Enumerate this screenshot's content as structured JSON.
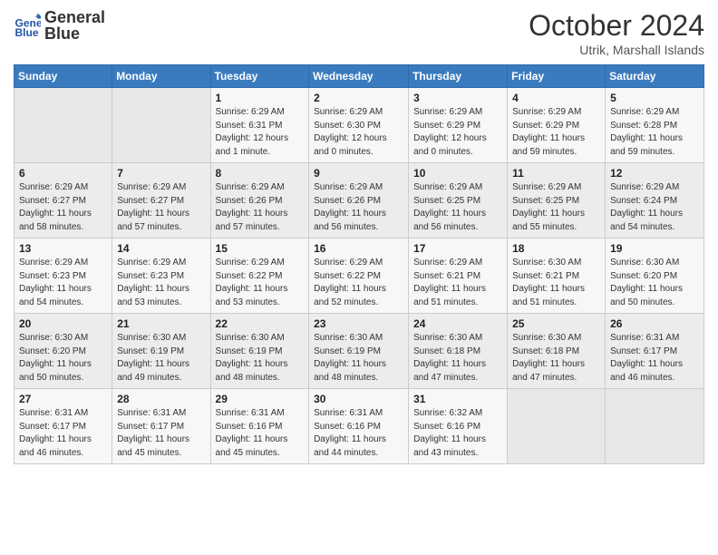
{
  "header": {
    "logo": {
      "line1": "General",
      "line2": "Blue"
    },
    "title": "October 2024",
    "location": "Utrik, Marshall Islands"
  },
  "weekdays": [
    "Sunday",
    "Monday",
    "Tuesday",
    "Wednesday",
    "Thursday",
    "Friday",
    "Saturday"
  ],
  "weeks": [
    [
      {
        "day": "",
        "detail": ""
      },
      {
        "day": "",
        "detail": ""
      },
      {
        "day": "1",
        "detail": "Sunrise: 6:29 AM\nSunset: 6:31 PM\nDaylight: 12 hours and 1 minute."
      },
      {
        "day": "2",
        "detail": "Sunrise: 6:29 AM\nSunset: 6:30 PM\nDaylight: 12 hours and 0 minutes."
      },
      {
        "day": "3",
        "detail": "Sunrise: 6:29 AM\nSunset: 6:29 PM\nDaylight: 12 hours and 0 minutes."
      },
      {
        "day": "4",
        "detail": "Sunrise: 6:29 AM\nSunset: 6:29 PM\nDaylight: 11 hours and 59 minutes."
      },
      {
        "day": "5",
        "detail": "Sunrise: 6:29 AM\nSunset: 6:28 PM\nDaylight: 11 hours and 59 minutes."
      }
    ],
    [
      {
        "day": "6",
        "detail": "Sunrise: 6:29 AM\nSunset: 6:27 PM\nDaylight: 11 hours and 58 minutes."
      },
      {
        "day": "7",
        "detail": "Sunrise: 6:29 AM\nSunset: 6:27 PM\nDaylight: 11 hours and 57 minutes."
      },
      {
        "day": "8",
        "detail": "Sunrise: 6:29 AM\nSunset: 6:26 PM\nDaylight: 11 hours and 57 minutes."
      },
      {
        "day": "9",
        "detail": "Sunrise: 6:29 AM\nSunset: 6:26 PM\nDaylight: 11 hours and 56 minutes."
      },
      {
        "day": "10",
        "detail": "Sunrise: 6:29 AM\nSunset: 6:25 PM\nDaylight: 11 hours and 56 minutes."
      },
      {
        "day": "11",
        "detail": "Sunrise: 6:29 AM\nSunset: 6:25 PM\nDaylight: 11 hours and 55 minutes."
      },
      {
        "day": "12",
        "detail": "Sunrise: 6:29 AM\nSunset: 6:24 PM\nDaylight: 11 hours and 54 minutes."
      }
    ],
    [
      {
        "day": "13",
        "detail": "Sunrise: 6:29 AM\nSunset: 6:23 PM\nDaylight: 11 hours and 54 minutes."
      },
      {
        "day": "14",
        "detail": "Sunrise: 6:29 AM\nSunset: 6:23 PM\nDaylight: 11 hours and 53 minutes."
      },
      {
        "day": "15",
        "detail": "Sunrise: 6:29 AM\nSunset: 6:22 PM\nDaylight: 11 hours and 53 minutes."
      },
      {
        "day": "16",
        "detail": "Sunrise: 6:29 AM\nSunset: 6:22 PM\nDaylight: 11 hours and 52 minutes."
      },
      {
        "day": "17",
        "detail": "Sunrise: 6:29 AM\nSunset: 6:21 PM\nDaylight: 11 hours and 51 minutes."
      },
      {
        "day": "18",
        "detail": "Sunrise: 6:30 AM\nSunset: 6:21 PM\nDaylight: 11 hours and 51 minutes."
      },
      {
        "day": "19",
        "detail": "Sunrise: 6:30 AM\nSunset: 6:20 PM\nDaylight: 11 hours and 50 minutes."
      }
    ],
    [
      {
        "day": "20",
        "detail": "Sunrise: 6:30 AM\nSunset: 6:20 PM\nDaylight: 11 hours and 50 minutes."
      },
      {
        "day": "21",
        "detail": "Sunrise: 6:30 AM\nSunset: 6:19 PM\nDaylight: 11 hours and 49 minutes."
      },
      {
        "day": "22",
        "detail": "Sunrise: 6:30 AM\nSunset: 6:19 PM\nDaylight: 11 hours and 48 minutes."
      },
      {
        "day": "23",
        "detail": "Sunrise: 6:30 AM\nSunset: 6:19 PM\nDaylight: 11 hours and 48 minutes."
      },
      {
        "day": "24",
        "detail": "Sunrise: 6:30 AM\nSunset: 6:18 PM\nDaylight: 11 hours and 47 minutes."
      },
      {
        "day": "25",
        "detail": "Sunrise: 6:30 AM\nSunset: 6:18 PM\nDaylight: 11 hours and 47 minutes."
      },
      {
        "day": "26",
        "detail": "Sunrise: 6:31 AM\nSunset: 6:17 PM\nDaylight: 11 hours and 46 minutes."
      }
    ],
    [
      {
        "day": "27",
        "detail": "Sunrise: 6:31 AM\nSunset: 6:17 PM\nDaylight: 11 hours and 46 minutes."
      },
      {
        "day": "28",
        "detail": "Sunrise: 6:31 AM\nSunset: 6:17 PM\nDaylight: 11 hours and 45 minutes."
      },
      {
        "day": "29",
        "detail": "Sunrise: 6:31 AM\nSunset: 6:16 PM\nDaylight: 11 hours and 45 minutes."
      },
      {
        "day": "30",
        "detail": "Sunrise: 6:31 AM\nSunset: 6:16 PM\nDaylight: 11 hours and 44 minutes."
      },
      {
        "day": "31",
        "detail": "Sunrise: 6:32 AM\nSunset: 6:16 PM\nDaylight: 11 hours and 43 minutes."
      },
      {
        "day": "",
        "detail": ""
      },
      {
        "day": "",
        "detail": ""
      }
    ]
  ]
}
